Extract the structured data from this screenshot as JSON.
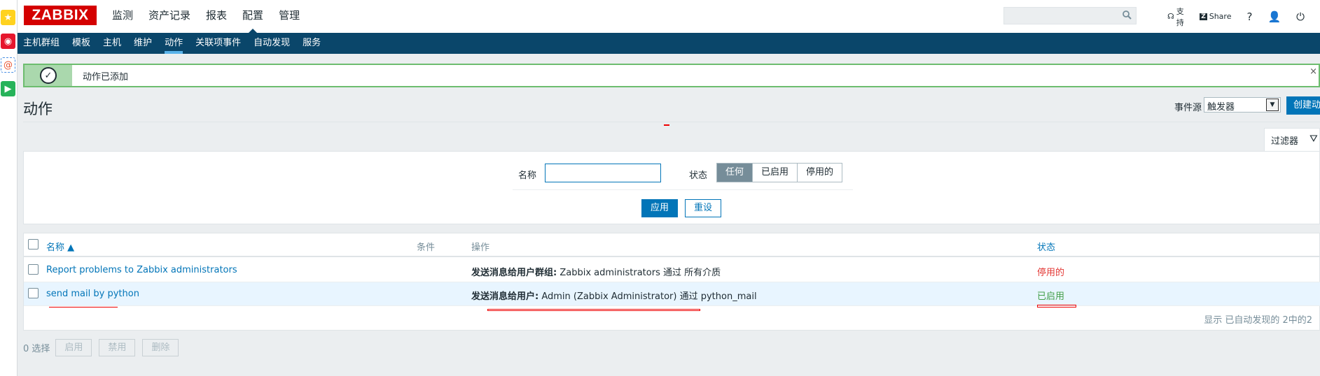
{
  "sidebar": {
    "icons": [
      "star-icon",
      "weibo-icon",
      "at-icon",
      "media-icon"
    ]
  },
  "header": {
    "logo": "ZABBIX",
    "nav": [
      {
        "label": "监测",
        "active": false
      },
      {
        "label": "资产记录",
        "active": false
      },
      {
        "label": "报表",
        "active": false
      },
      {
        "label": "配置",
        "active": true
      },
      {
        "label": "管理",
        "active": false
      }
    ],
    "search_placeholder": "",
    "support": "支持",
    "share": "Share",
    "help": "?",
    "user_icon": "user-icon",
    "logout_icon": "power-icon"
  },
  "subnav": [
    {
      "label": "主机群组",
      "active": false
    },
    {
      "label": "模板",
      "active": false
    },
    {
      "label": "主机",
      "active": false
    },
    {
      "label": "维护",
      "active": false
    },
    {
      "label": "动作",
      "active": true
    },
    {
      "label": "关联项事件",
      "active": false
    },
    {
      "label": "自动发现",
      "active": false
    },
    {
      "label": "服务",
      "active": false
    }
  ],
  "message": {
    "text": "动作已添加",
    "close": "×"
  },
  "page": {
    "title": "动作",
    "event_source_label": "事件源",
    "event_source_value": "触发器",
    "create_button": "创建动作"
  },
  "filter": {
    "tab_label": "过滤器",
    "name_label": "名称",
    "name_value": "",
    "status_label": "状态",
    "status_options": [
      {
        "label": "任何",
        "active": true
      },
      {
        "label": "已启用",
        "active": false
      },
      {
        "label": "停用的",
        "active": false
      }
    ],
    "apply": "应用",
    "reset": "重设"
  },
  "table": {
    "headers": {
      "name": "名称 ▲",
      "conditions": "条件",
      "operations": "操作",
      "status": "状态"
    },
    "rows": [
      {
        "name": "Report problems to Zabbix administrators",
        "conditions": "",
        "op_bold": "发送消息给用户群组:",
        "op_rest": " Zabbix administrators 通过 所有介质",
        "status": "停用的",
        "status_state": "disabled"
      },
      {
        "name": "send mail by python",
        "conditions": "",
        "op_bold": "发送消息给用户:",
        "op_rest": " Admin (Zabbix Administrator) 通过 python_mail",
        "status": "已启用",
        "status_state": "enabled"
      }
    ],
    "footer": "显示 已自动发现的 2中的2"
  },
  "bottom": {
    "selected": "0 选择",
    "buttons": [
      "启用",
      "禁用",
      "删除"
    ]
  },
  "colors": {
    "brand": "#d40000",
    "nav_bg": "#0a466a",
    "accent": "#0275b8",
    "success_border": "#6dbd6f",
    "disabled_status": "#e33734",
    "enabled_status": "#429e47"
  }
}
